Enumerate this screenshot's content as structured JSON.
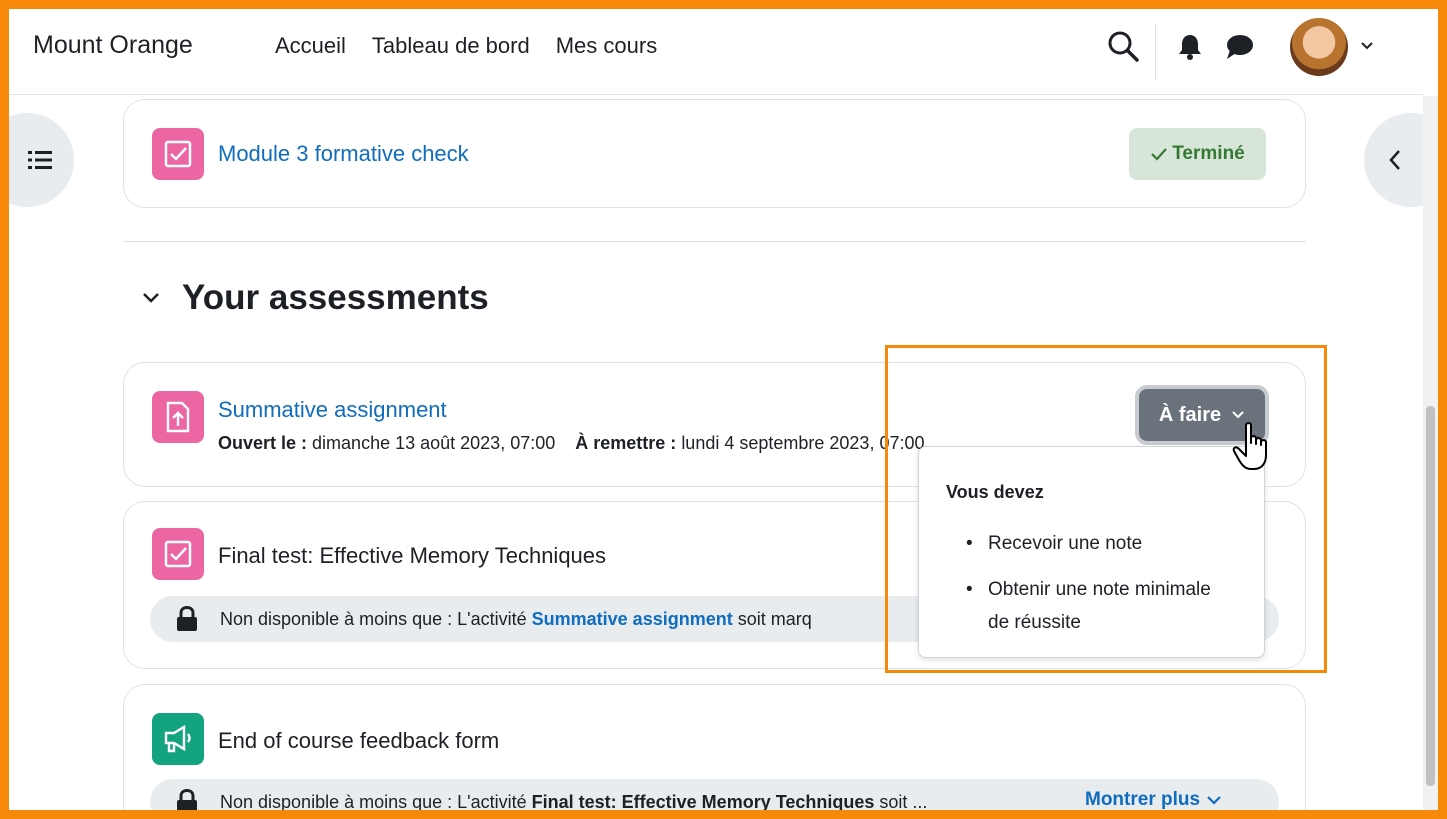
{
  "nav": {
    "brand": "Mount Orange",
    "links": [
      "Accueil",
      "Tableau de bord",
      "Mes cours"
    ],
    "icons": [
      "search-icon",
      "bell-icon",
      "chat-icon",
      "avatar",
      "chevron-down-icon"
    ]
  },
  "top_card": {
    "title": "Module 3 formative check",
    "badge": "Terminé",
    "icon": "quiz-icon"
  },
  "section": {
    "title": "Your assessments",
    "icon": "chevron-down-icon"
  },
  "assignment": {
    "title": "Summative assignment",
    "open_label": "Ouvert le :",
    "open_value": "dimanche 13 août 2023, 07:00",
    "due_label": "À remettre :",
    "due_value": "lundi 4 septembre 2023, 07:00",
    "status_button": "À faire",
    "icon": "assignment-icon"
  },
  "dropdown": {
    "heading": "Vous devez",
    "items": [
      "Recevoir une note",
      "Obtenir une note minimale de réussite"
    ]
  },
  "final_test": {
    "title": "Final test: Effective Memory Techniques",
    "restriction_prefix": "Non disponible à moins que : L'activité",
    "restriction_link": "Summative assignment",
    "restriction_suffix": "soit marq",
    "icon": "quiz-icon"
  },
  "feedback": {
    "title": "End of course feedback form",
    "restriction_prefix": "Non disponible à moins que : L'activité",
    "restriction_strong": "Final test: Effective Memory Techniques",
    "restriction_suffix": "soit ...",
    "show_more": "Montrer plus",
    "icon": "feedback-icon"
  },
  "colors": {
    "frame": "#f7890a",
    "link": "#0f6cbf",
    "pink_icon": "#eb66a2",
    "green_icon": "#14a37f",
    "done_bg": "#d7e6d9",
    "done_text": "#357a32",
    "todo_bg": "#6a737b"
  }
}
